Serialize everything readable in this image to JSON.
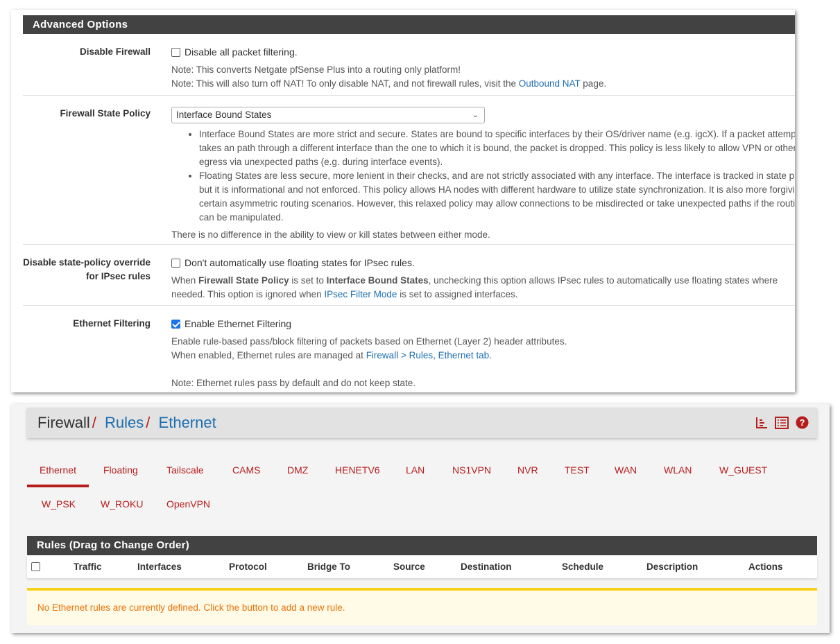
{
  "advanced": {
    "title": "Advanced Options",
    "disable_firewall": {
      "label": "Disable Firewall",
      "checkbox": "Disable all packet filtering.",
      "checked": false,
      "note1": "Note: This converts Netgate pfSense Plus into a routing only platform!",
      "note2_pre": "Note: This will also turn off NAT! To only disable NAT, and not firewall rules, visit the ",
      "note2_link": "Outbound NAT",
      "note2_post": " page."
    },
    "state_policy": {
      "label": "Firewall State Policy",
      "selected": "Interface Bound States",
      "bullets": [
        "Interface Bound States are more strict and secure. States are bound to specific interfaces by their OS/driver name (e.g. igcX). If a packet attempts to takes an path through a different interface than the one to which it is bound, the packet is dropped. This policy is less likely to allow VPN or other traffic to egress via unexpected paths (e.g. during interface events).",
        "Floating States are less secure, more lenient in their checks, and are not strictly associated with any interface. The interface is tracked in state properties, but it is informational and not enforced. This policy allows HA nodes with different hardware to utilize state synchronization. It is also more forgiving of certain asymmetric routing scenarios. However, this relaxed policy may allow connections to be misdirected or take unexpected paths if the routing table can be manipulated."
      ],
      "footer": "There is no difference in the ability to view or kill states between either mode."
    },
    "ipsec": {
      "label": "Disable state-policy override for IPsec rules",
      "checkbox": "Don't automatically use floating states for IPsec rules.",
      "checked": false,
      "h1": "When ",
      "b1": "Firewall State Policy",
      "h2": " is set to ",
      "b2": "Interface Bound States",
      "h3": ", unchecking this option allows IPsec rules to automatically use floating states where needed. This option is ignored when ",
      "link": "IPsec Filter Mode",
      "h4": " is set to assigned interfaces."
    },
    "ethernet": {
      "label": "Ethernet Filtering",
      "checkbox": "Enable Ethernet Filtering",
      "checked": true,
      "help1": "Enable rule-based pass/block filtering of packets based on Ethernet (Layer 2) header attributes.",
      "help2_pre": "When enabled, Ethernet rules are managed at ",
      "help2_link": "Firewall > Rules, Ethernet tab.",
      "note": "Note: Ethernet rules pass by default and do not keep state."
    }
  },
  "breadcrumb": {
    "root": "Firewall",
    "sep": "/",
    "rules": "Rules",
    "current": "Ethernet"
  },
  "header_icons": [
    "chart-icon",
    "list-icon",
    "help-icon"
  ],
  "tabs": [
    {
      "label": "Ethernet",
      "active": true
    },
    {
      "label": "Floating"
    },
    {
      "label": "Tailscale"
    },
    {
      "label": "CAMS"
    },
    {
      "label": "DMZ"
    },
    {
      "label": "HENETV6"
    },
    {
      "label": "LAN"
    },
    {
      "label": "NS1VPN"
    },
    {
      "label": "NVR"
    },
    {
      "label": "TEST"
    },
    {
      "label": "WAN"
    },
    {
      "label": "WLAN"
    },
    {
      "label": "W_GUEST"
    },
    {
      "label": "W_PSK"
    },
    {
      "label": "W_ROKU"
    },
    {
      "label": "OpenVPN"
    }
  ],
  "rules": {
    "title": "Rules (Drag to Change Order)",
    "columns": [
      "Traffic",
      "Interfaces",
      "Protocol",
      "Bridge To",
      "Source",
      "Destination",
      "Schedule",
      "Description",
      "Actions"
    ],
    "empty": "No Ethernet rules are currently defined. Click the button to add a new rule."
  },
  "colors": {
    "accent": "#b71c1c",
    "link": "#1e6eb0",
    "header": "#424242",
    "warning": "#e8720c"
  }
}
